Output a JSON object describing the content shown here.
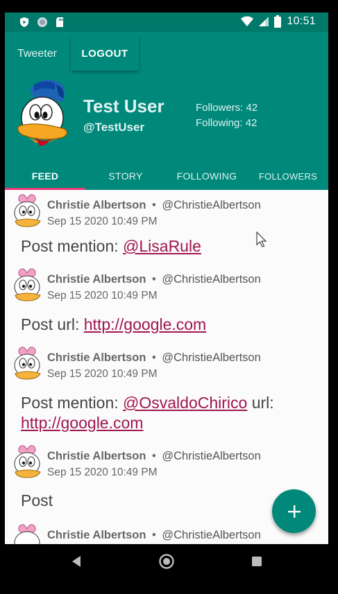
{
  "status_bar": {
    "time": "10:51"
  },
  "header": {
    "app_title": "Tweeter",
    "logout_label": "LOGOUT",
    "user_name": "Test User",
    "user_handle": "@TestUser",
    "followers": "Followers: 42",
    "following": "Following: 42"
  },
  "tabs": [
    {
      "label": "FEED",
      "active": true
    },
    {
      "label": "STORY",
      "active": false
    },
    {
      "label": "FOLLOWING",
      "active": false
    },
    {
      "label": "FOLLOWERS",
      "active": false
    }
  ],
  "feed": [
    {
      "author": "Christie Albertson",
      "separator": "•",
      "handle": "@ChristieAlbertson",
      "timestamp": "Sep 15 2020  10:49 PM",
      "text_1": "Post  mention: ",
      "link_1": "@LisaRule"
    },
    {
      "author": "Christie Albertson",
      "separator": "•",
      "handle": "@ChristieAlbertson",
      "timestamp": "Sep 15 2020  10:49 PM",
      "text_1": "Post  url:  ",
      "link_1": "http://google.com"
    },
    {
      "author": "Christie Albertson",
      "separator": "•",
      "handle": "@ChristieAlbertson",
      "timestamp": "Sep 15 2020  10:49 PM",
      "text_1": "Post  mention: ",
      "link_1": "@OsvaldoChirico",
      "text_2": " url:",
      "link_2": "http://google.com"
    },
    {
      "author": "Christie Albertson",
      "separator": "•",
      "handle": "@ChristieAlbertson",
      "timestamp": "Sep 15 2020  10:49 PM",
      "text_1": "Post"
    },
    {
      "author": "Christie Albertson",
      "separator": "•",
      "handle": "@ChristieAlbertson"
    }
  ],
  "fab": {
    "icon": "plus-icon"
  },
  "colors": {
    "primary": "#00897b",
    "primary_dark": "#00796b",
    "accent": "#e53972",
    "link": "#a0154e"
  }
}
